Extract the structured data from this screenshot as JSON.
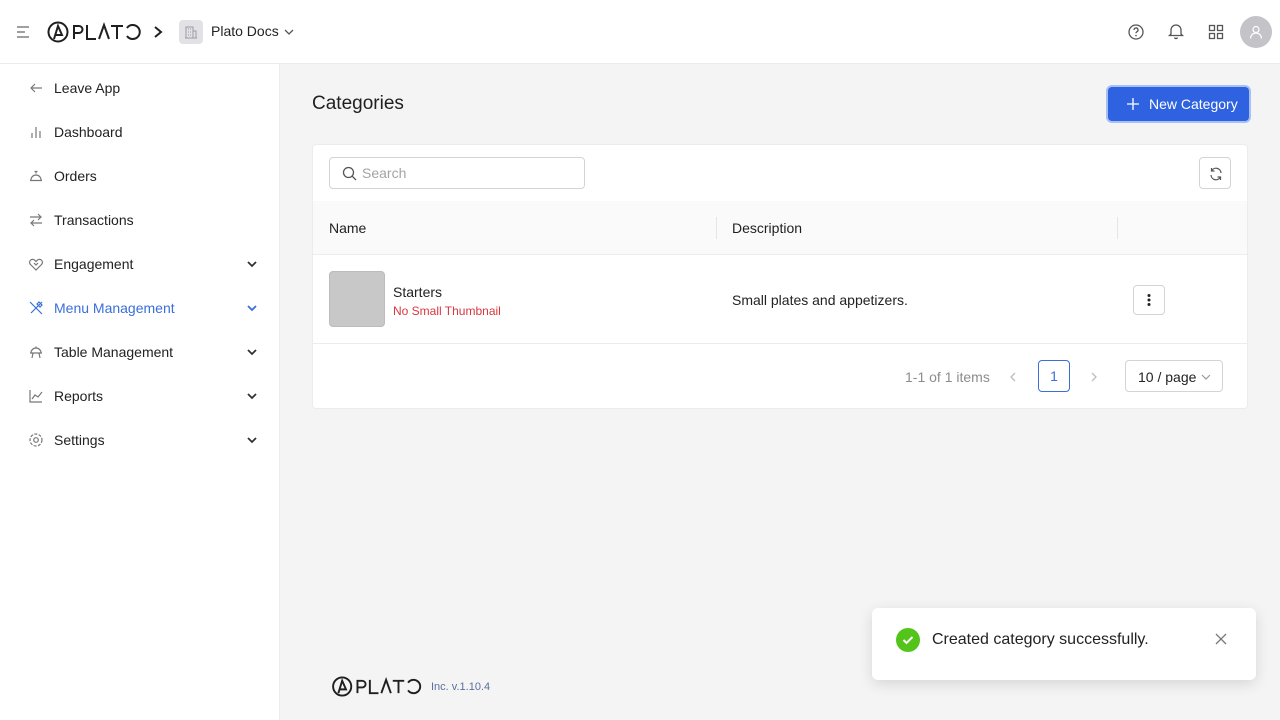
{
  "header": {
    "brand": "PLATO",
    "org_name": "Plato Docs"
  },
  "sidebar": {
    "items": [
      {
        "label": "Leave App",
        "icon": "arrow-left-icon"
      },
      {
        "label": "Dashboard",
        "icon": "bar-chart-icon"
      },
      {
        "label": "Orders",
        "icon": "cloche-icon"
      },
      {
        "label": "Transactions",
        "icon": "swap-icon"
      },
      {
        "label": "Engagement",
        "icon": "heart-handshake-icon",
        "expandable": true
      },
      {
        "label": "Menu Management",
        "icon": "utensils-icon",
        "expandable": true,
        "active": true
      },
      {
        "label": "Table Management",
        "icon": "table-bell-icon",
        "expandable": true
      },
      {
        "label": "Reports",
        "icon": "line-chart-icon",
        "expandable": true
      },
      {
        "label": "Settings",
        "icon": "gear-icon",
        "expandable": true
      }
    ]
  },
  "main": {
    "title": "Categories",
    "new_button_label": "New Category",
    "search_placeholder": "Search",
    "columns": {
      "name": "Name",
      "description": "Description"
    },
    "rows": [
      {
        "name": "Starters",
        "warning": "No Small Thumbnail",
        "description": "Small plates and appetizers."
      }
    ],
    "pagination": {
      "total_text": "1-1 of 1 items",
      "current_page": "1",
      "page_size": "10 / page"
    }
  },
  "footer": {
    "brand": "PLATO",
    "version": "Inc. v.1.10.4"
  },
  "toast": {
    "message": "Created category successfully."
  },
  "colors": {
    "accent": "#2f62e0",
    "active_nav": "#3a6fd8",
    "success": "#52c41a",
    "warning_text": "#d9363e"
  }
}
